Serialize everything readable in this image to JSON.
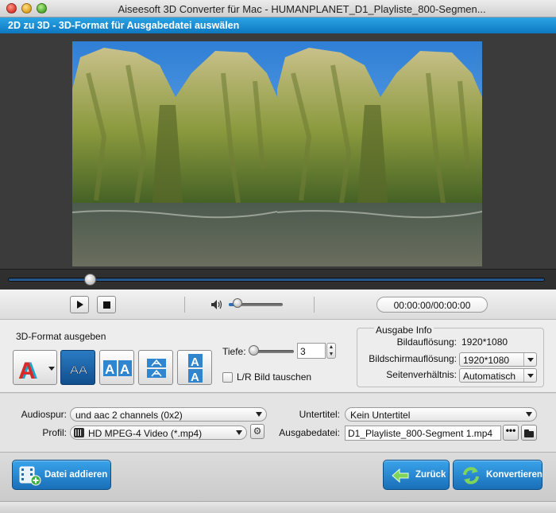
{
  "window": {
    "title": "Aiseesoft 3D Converter für Mac - HUMANPLANET_D1_Playliste_800-Segmen..."
  },
  "header": {
    "title": "2D zu 3D - 3D-Format für Ausgabedatei auswälen"
  },
  "player": {
    "time": "00:00:00/00:00:00",
    "seek_position": 0.16,
    "volume_level": 0.18
  },
  "format_panel": {
    "label": "3D-Format ausgeben",
    "formats": [
      "Anaglyph",
      "Side by Side (Half-Width)",
      "Side by Side (Full)",
      "Top and Bottom (Half-Height)",
      "Top and Bottom (Full)"
    ],
    "selected_format": 1,
    "depth_label": "Tiefe:",
    "depth_value": "3",
    "swap_label": "L/R Bild tauschen",
    "swap_checked": false
  },
  "output_info": {
    "title": "Ausgabe Info",
    "resolution_label": "Bildauflösung:",
    "resolution_value": "1920*1080",
    "screen_label": "Bildschirmauflösung:",
    "screen_value": "1920*1080",
    "aspect_label": "Seitenverhältnis:",
    "aspect_value": "Automatisch"
  },
  "options": {
    "audio_label": "Audiospur:",
    "audio_value": "und aac 2 channels (0x2)",
    "profile_label": "Profil:",
    "profile_value": "HD MPEG-4 Video (*.mp4)",
    "subtitle_label": "Untertitel:",
    "subtitle_value": "Kein Untertitel",
    "output_label": "Ausgabedatei:",
    "output_value": "D1_Playliste_800-Segment 1.mp4",
    "browse_label": "•••"
  },
  "actions": {
    "add_label": "Datei addieren",
    "back_label": "Zurück",
    "convert_label": "Konvertieren"
  },
  "colors": {
    "header_band": "#1a8fd6",
    "button_blue": "#2a88d0",
    "selected_format": "#1c64a8"
  }
}
